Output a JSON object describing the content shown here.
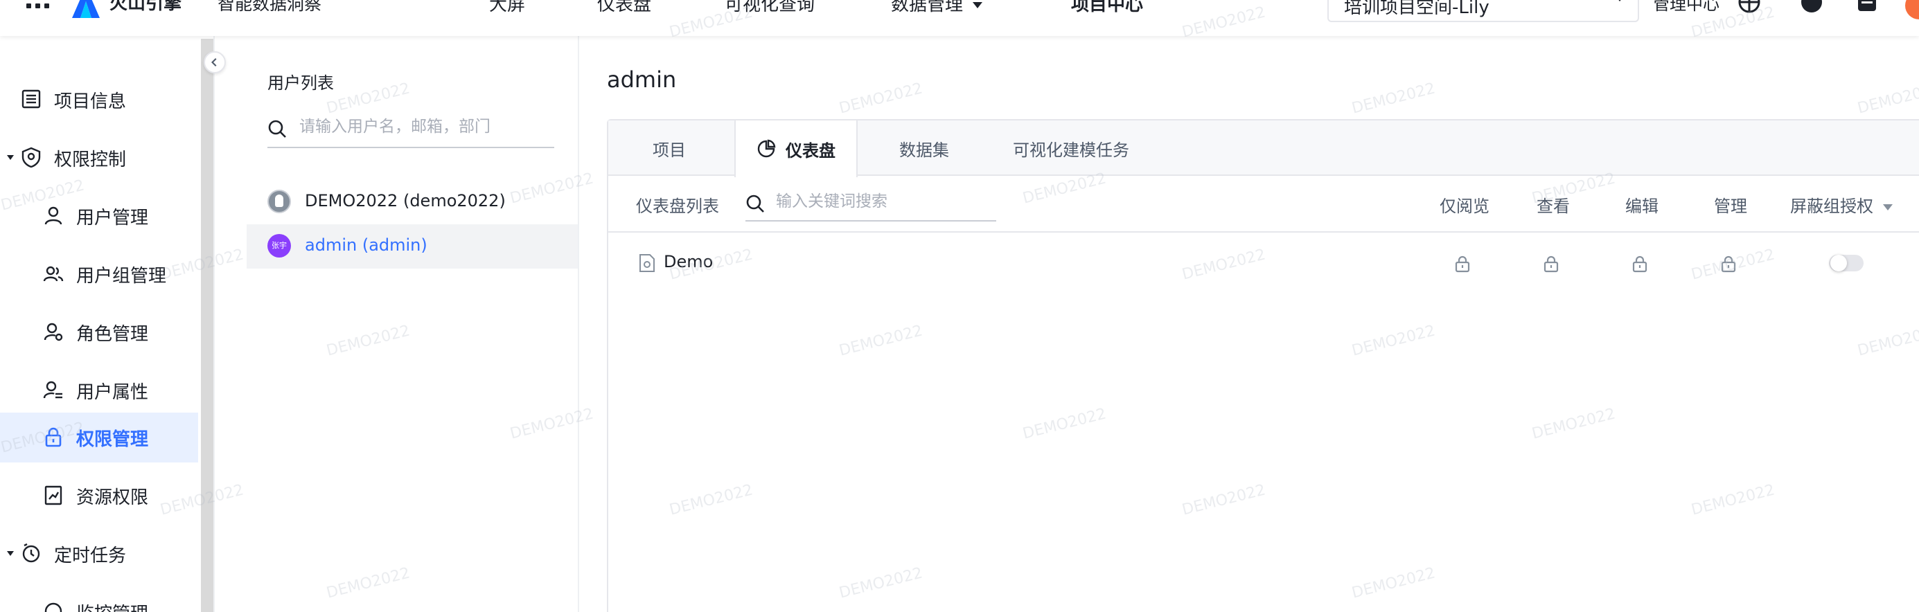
{
  "topbar": {
    "brand": "火山引擎",
    "product": "智能数据洞察",
    "nav": [
      "大屏",
      "仪表盘",
      "可视化查询",
      "数据管理",
      "项目中心"
    ],
    "workspace": "培训项目空间-Lily",
    "management": "管理中心"
  },
  "sidebar": {
    "items": [
      {
        "label": "项目信息",
        "icon": "list-icon"
      },
      {
        "label": "权限控制",
        "icon": "shield-icon"
      },
      {
        "label": "用户管理",
        "icon": "user-icon"
      },
      {
        "label": "用户组管理",
        "icon": "user-group-icon"
      },
      {
        "label": "角色管理",
        "icon": "user-gear-icon"
      },
      {
        "label": "用户属性",
        "icon": "user-attribute-icon"
      },
      {
        "label": "权限管理",
        "icon": "lock-icon"
      },
      {
        "label": "资源权限",
        "icon": "resource-icon"
      },
      {
        "label": "定时任务",
        "icon": "clock-icon"
      },
      {
        "label": "监控管理",
        "icon": "monitor-icon"
      }
    ]
  },
  "userpanel": {
    "title": "用户列表",
    "search_placeholder": "请输入用户名，邮箱，部门",
    "users": [
      {
        "name": "DEMO2022 (demo2022)"
      },
      {
        "name": "admin (admin)",
        "avatar_text": "张宇"
      }
    ]
  },
  "main": {
    "title": "admin",
    "tabs": [
      "项目",
      "仪表盘",
      "数据集",
      "可视化建模任务"
    ],
    "list_label": "仪表盘列表",
    "search_placeholder": "输入关键词搜索",
    "columns": [
      "仅阅览",
      "查看",
      "编辑",
      "管理",
      "屏蔽组授权"
    ],
    "rows": [
      {
        "name": "Demo"
      }
    ]
  },
  "watermark": "DEMO2022",
  "colors": {
    "accent": "#3370ff",
    "active_bg": "#e8f0ff",
    "avatar": "#8a3ffc"
  }
}
